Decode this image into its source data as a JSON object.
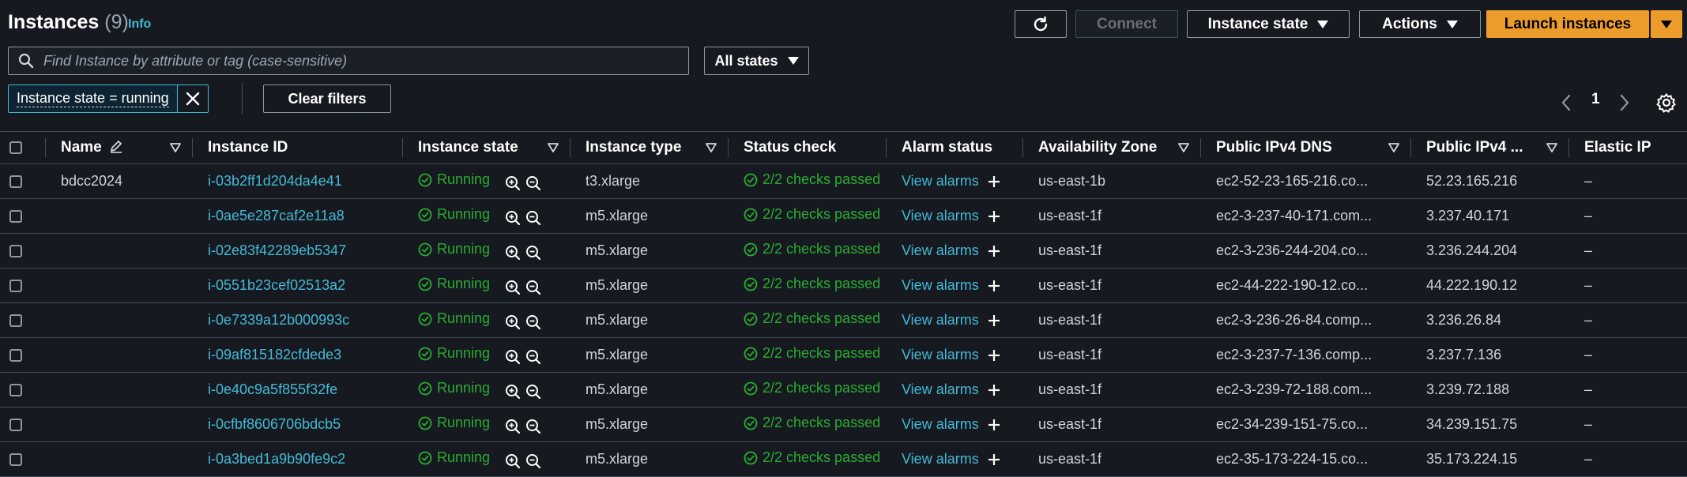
{
  "header": {
    "title": "Instances",
    "count": "(9)",
    "info_link": "Info"
  },
  "toolbar": {
    "refresh_icon": "refresh-icon",
    "connect": "Connect",
    "instance_state": "Instance state",
    "actions": "Actions",
    "launch": "Launch instances"
  },
  "search": {
    "placeholder": "Find Instance by attribute or tag (case-sensitive)",
    "states_select": "All states"
  },
  "filters": {
    "token": "Instance state = running",
    "clear": "Clear filters"
  },
  "pagination": {
    "page": "1"
  },
  "columns": [
    "Name",
    "Instance ID",
    "Instance state",
    "Instance type",
    "Status check",
    "Alarm status",
    "Availability Zone",
    "Public IPv4 DNS",
    "Public IPv4 ...",
    "Elastic IP"
  ],
  "rows": [
    {
      "name": "bdcc2024",
      "id": "i-03b2ff1d204da4e41",
      "state": "Running",
      "type": "t3.xlarge",
      "status": "2/2 checks passed",
      "alarm": "View alarms",
      "az": "us-east-1b",
      "dns": "ec2-52-23-165-216.co...",
      "ip": "52.23.165.216",
      "eip": "–"
    },
    {
      "name": "",
      "id": "i-0ae5e287caf2e11a8",
      "state": "Running",
      "type": "m5.xlarge",
      "status": "2/2 checks passed",
      "alarm": "View alarms",
      "az": "us-east-1f",
      "dns": "ec2-3-237-40-171.com...",
      "ip": "3.237.40.171",
      "eip": "–"
    },
    {
      "name": "",
      "id": "i-02e83f42289eb5347",
      "state": "Running",
      "type": "m5.xlarge",
      "status": "2/2 checks passed",
      "alarm": "View alarms",
      "az": "us-east-1f",
      "dns": "ec2-3-236-244-204.co...",
      "ip": "3.236.244.204",
      "eip": "–"
    },
    {
      "name": "",
      "id": "i-0551b23cef02513a2",
      "state": "Running",
      "type": "m5.xlarge",
      "status": "2/2 checks passed",
      "alarm": "View alarms",
      "az": "us-east-1f",
      "dns": "ec2-44-222-190-12.co...",
      "ip": "44.222.190.12",
      "eip": "–"
    },
    {
      "name": "",
      "id": "i-0e7339a12b000993c",
      "state": "Running",
      "type": "m5.xlarge",
      "status": "2/2 checks passed",
      "alarm": "View alarms",
      "az": "us-east-1f",
      "dns": "ec2-3-236-26-84.comp...",
      "ip": "3.236.26.84",
      "eip": "–"
    },
    {
      "name": "",
      "id": "i-09af815182cfdede3",
      "state": "Running",
      "type": "m5.xlarge",
      "status": "2/2 checks passed",
      "alarm": "View alarms",
      "az": "us-east-1f",
      "dns": "ec2-3-237-7-136.comp...",
      "ip": "3.237.7.136",
      "eip": "–"
    },
    {
      "name": "",
      "id": "i-0e40c9a5f855f32fe",
      "state": "Running",
      "type": "m5.xlarge",
      "status": "2/2 checks passed",
      "alarm": "View alarms",
      "az": "us-east-1f",
      "dns": "ec2-3-239-72-188.com...",
      "ip": "3.239.72.188",
      "eip": "–"
    },
    {
      "name": "",
      "id": "i-0cfbf8606706bdcb5",
      "state": "Running",
      "type": "m5.xlarge",
      "status": "2/2 checks passed",
      "alarm": "View alarms",
      "az": "us-east-1f",
      "dns": "ec2-34-239-151-75.co...",
      "ip": "34.239.151.75",
      "eip": "–"
    },
    {
      "name": "",
      "id": "i-0a3bed1a9b90fe9c2",
      "state": "Running",
      "type": "m5.xlarge",
      "status": "2/2 checks passed",
      "alarm": "View alarms",
      "az": "us-east-1f",
      "dns": "ec2-35-173-224-15.co...",
      "ip": "35.173.224.15",
      "eip": "–"
    }
  ],
  "colors": {
    "background": "#16191f",
    "link": "#44b9d6",
    "success": "#29ad32",
    "primary": "#ec9c2b"
  }
}
